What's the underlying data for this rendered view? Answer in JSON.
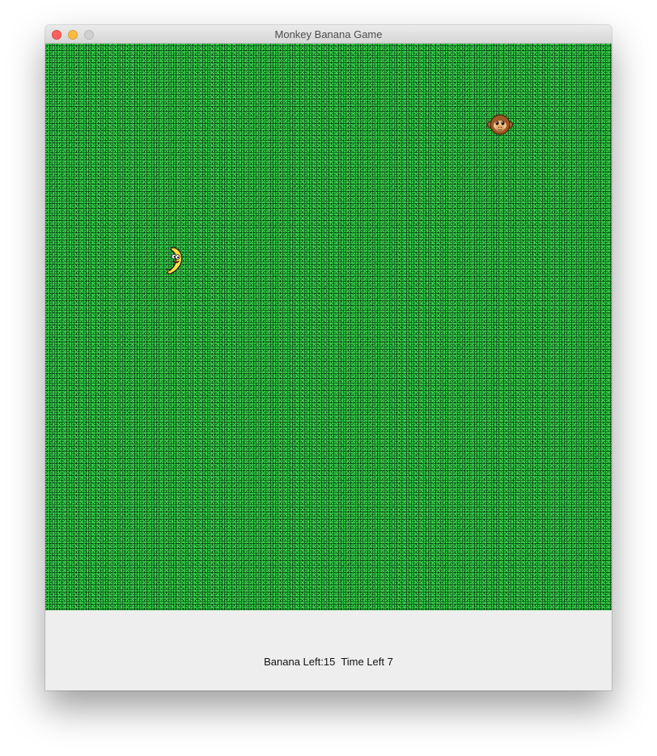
{
  "window": {
    "title": "Monkey Banana Game"
  },
  "game": {
    "sprites": [
      {
        "name": "monkey",
        "icon": "monkey-face-icon"
      },
      {
        "name": "banana",
        "icon": "smiling-banana-icon"
      }
    ],
    "background": "green-grass-noise"
  },
  "status": {
    "banana_label": "Banana Left:",
    "banana_count": "15",
    "time_label": "Time Left",
    "time_value": "7"
  },
  "colors": {
    "grass": "#1e7b2c",
    "statusbar": "#eeeeee",
    "close": "#fc605c",
    "minimize": "#fdbc40",
    "maximize": "#d0d0d0"
  }
}
